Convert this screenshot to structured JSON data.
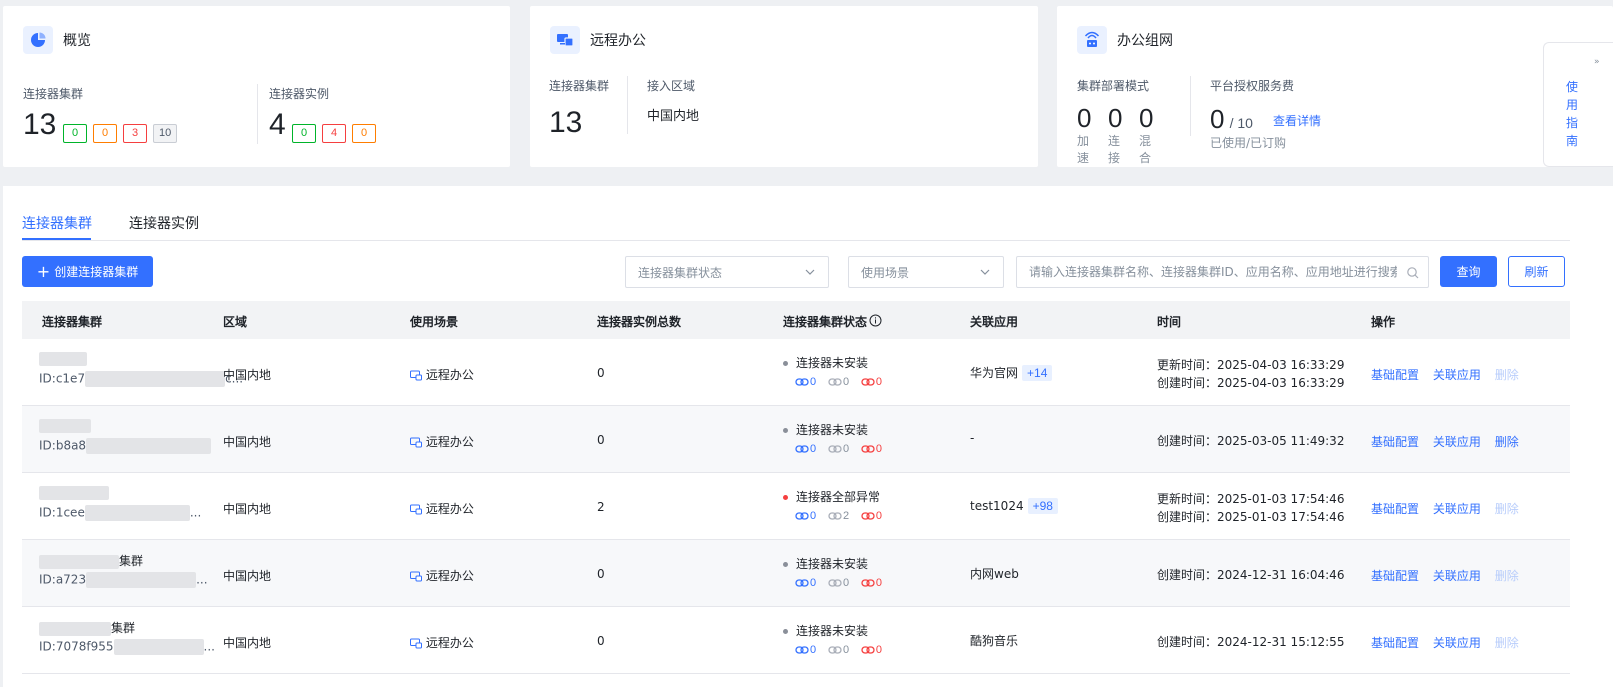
{
  "overview": {
    "title": "概览",
    "cluster_label": "连接器集群",
    "cluster_count": "13",
    "cluster_badges": [
      "0",
      "0",
      "3",
      "10"
    ],
    "instance_label": "连接器实例",
    "instance_count": "4",
    "instance_badges": [
      "0",
      "4",
      "0"
    ]
  },
  "remote": {
    "title": "远程办公",
    "cluster_label": "连接器集群",
    "cluster_count": "13",
    "region_label": "接入区域",
    "region_value": "中国内地"
  },
  "network": {
    "title": "办公组网",
    "mode_label": "集群部署模式",
    "modes": [
      {
        "value": "0",
        "label": "加速"
      },
      {
        "value": "0",
        "label": "连接"
      },
      {
        "value": "0",
        "label": "混合"
      }
    ],
    "fee_label": "平台授权服务费",
    "fee_used": "0",
    "fee_total": "/ 10",
    "fee_caption": "已使用/已订购",
    "details_link": "查看详情"
  },
  "tabs": [
    "连接器集群",
    "连接器实例"
  ],
  "toolbar": {
    "create_label": "创建连接器集群",
    "status_placeholder": "连接器集群状态",
    "scene_placeholder": "使用场景",
    "search_placeholder": "请输入连接器集群名称、连接器集群ID、应用名称、应用地址进行搜索",
    "query_label": "查询",
    "refresh_label": "刷新"
  },
  "table": {
    "headers": [
      "连接器集群",
      "区域",
      "使用场景",
      "连接器实例总数",
      "连接器集群状态",
      "关联应用",
      "时间",
      "操作"
    ],
    "rows": [
      {
        "name": "",
        "id": "ID:c1e7",
        "id_tail": "c...",
        "region": "中国内地",
        "scene": "远程办公",
        "count": "0",
        "status": "连接器未安装",
        "status_color": "#8a8f99",
        "s1": "0",
        "s2": "0",
        "s3": "0",
        "app": "华为官网",
        "app_plus": "+14",
        "updated": "更新时间：2025-04-03 16:33:29",
        "created": "创建时间：2025-04-03 16:33:29",
        "op1": "基础配置",
        "op2": "关联应用",
        "op3": "删除",
        "delete_enabled": false
      },
      {
        "name": "",
        "id": "ID:b8a8",
        "id_tail": "",
        "region": "中国内地",
        "scene": "远程办公",
        "count": "0",
        "status": "连接器未安装",
        "status_color": "#8a8f99",
        "s1": "0",
        "s2": "0",
        "s3": "0",
        "app": "-",
        "app_plus": "",
        "updated": "",
        "created": "创建时间：2025-03-05 11:49:32",
        "op1": "基础配置",
        "op2": "关联应用",
        "op3": "删除",
        "delete_enabled": true
      },
      {
        "name": "",
        "id": "ID:1cee",
        "id_tail": "...",
        "region": "中国内地",
        "scene": "远程办公",
        "count": "2",
        "status": "连接器全部异常",
        "status_color": "#f53f3f",
        "s1": "0",
        "s2": "2",
        "s3": "0",
        "app": "test1024",
        "app_plus": "+98",
        "updated": "更新时间：2025-01-03 17:54:46",
        "created": "创建时间：2025-01-03 17:54:46",
        "op1": "基础配置",
        "op2": "关联应用",
        "op3": "删除",
        "delete_enabled": false
      },
      {
        "name": "集群",
        "id": "ID:a723",
        "id_tail": "...",
        "region": "中国内地",
        "scene": "远程办公",
        "count": "0",
        "status": "连接器未安装",
        "status_color": "#8a8f99",
        "s1": "0",
        "s2": "0",
        "s3": "0",
        "app": "内网web",
        "app_plus": "",
        "updated": "",
        "created": "创建时间：2024-12-31 16:04:46",
        "op1": "基础配置",
        "op2": "关联应用",
        "op3": "删除",
        "delete_enabled": false
      },
      {
        "name": "集群",
        "id": "ID:7078f955",
        "id_tail": "...",
        "region": "中国内地",
        "scene": "远程办公",
        "count": "0",
        "status": "连接器未安装",
        "status_color": "#8a8f99",
        "s1": "0",
        "s2": "0",
        "s3": "0",
        "app": "酷狗音乐",
        "app_plus": "",
        "updated": "",
        "created": "创建时间：2024-12-31 15:12:55",
        "op1": "基础配置",
        "op2": "关联应用",
        "op3": "删除",
        "delete_enabled": false
      }
    ]
  },
  "side_panel": {
    "chars": [
      "使",
      "用",
      "指",
      "南"
    ]
  }
}
